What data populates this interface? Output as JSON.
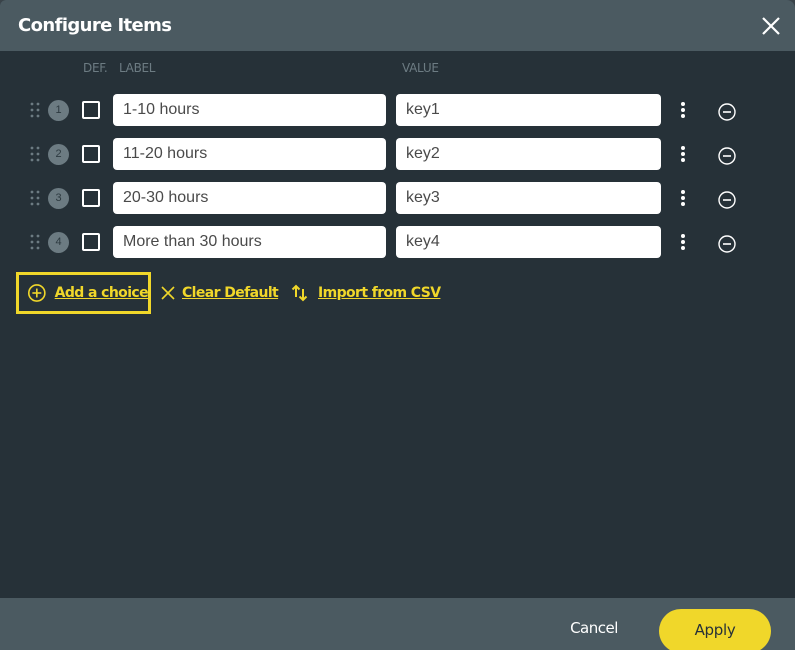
{
  "dialog": {
    "title": "Configure Items",
    "close_icon": "close-icon"
  },
  "columns": {
    "default": "DEF.",
    "label": "LABEL",
    "value": "VALUE"
  },
  "items": [
    {
      "index": "1",
      "is_default": false,
      "label": "1-10 hours",
      "value": "key1"
    },
    {
      "index": "2",
      "is_default": false,
      "label": "11-20 hours",
      "value": "key2"
    },
    {
      "index": "3",
      "is_default": false,
      "label": "20-30 hours",
      "value": "key3"
    },
    {
      "index": "4",
      "is_default": false,
      "label": "More than 30 hours",
      "value": "key4"
    }
  ],
  "actions": {
    "add_choice": "Add a choice",
    "clear_default": "Clear Default",
    "import_csv": "Import from CSV"
  },
  "footer": {
    "cancel": "Cancel",
    "apply": "Apply"
  },
  "colors": {
    "accent": "#f0d72a",
    "header_bg": "#4b5a61",
    "body_bg": "#263138",
    "muted_text": "#6d7c83"
  }
}
